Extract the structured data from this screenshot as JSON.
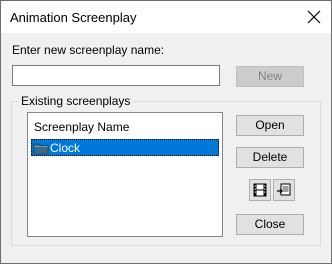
{
  "window": {
    "title": "Animation Screenplay"
  },
  "form": {
    "name_prompt": "Enter new screenplay name:",
    "name_value": "",
    "new_label": "New"
  },
  "group": {
    "title": "Existing screenplays",
    "list_header": "Screenplay Name",
    "items": [
      {
        "label": "Clock",
        "selected": true
      }
    ]
  },
  "buttons": {
    "open_label": "Open",
    "delete_label": "Delete",
    "close_label": "Close"
  },
  "icons": {
    "close": "close-icon",
    "folder": "folder-icon",
    "film": "film-strip-icon",
    "export": "export-icon"
  },
  "colors": {
    "selection": "#0078d7"
  }
}
